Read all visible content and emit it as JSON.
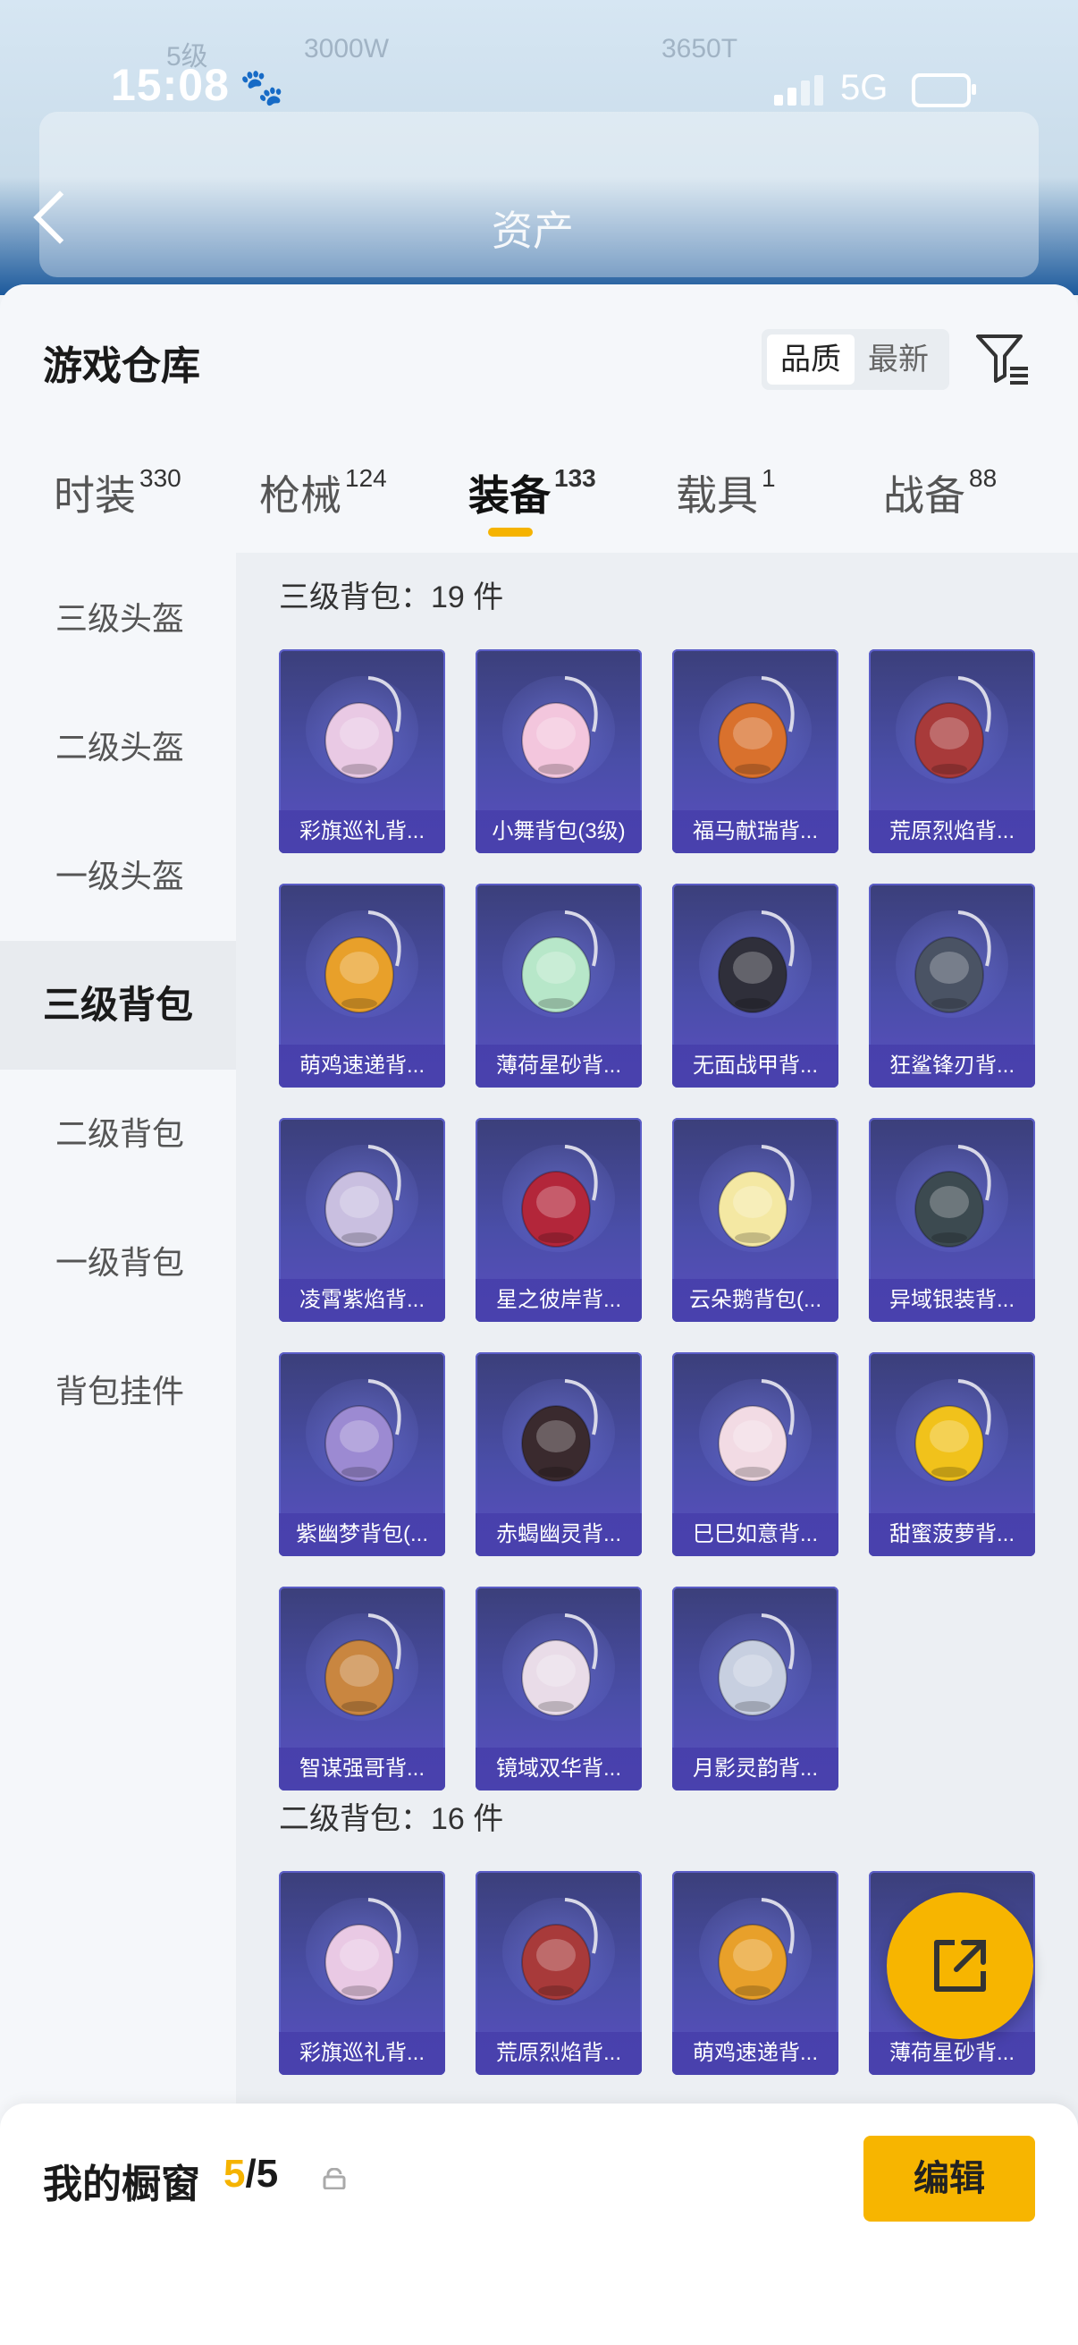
{
  "status_bar": {
    "time": "15:08",
    "network": "5G"
  },
  "header": {
    "title": "资产"
  },
  "background_stats": [
    "5级",
    "3000W",
    "3650T"
  ],
  "warehouse": {
    "title": "游戏仓库",
    "sort_options": [
      "品质",
      "最新"
    ],
    "selected_sort": "品质"
  },
  "tabs": [
    {
      "label": "时装",
      "count": "330"
    },
    {
      "label": "枪械",
      "count": "124"
    },
    {
      "label": "装备",
      "count": "133"
    },
    {
      "label": "载具",
      "count": "1"
    },
    {
      "label": "战备",
      "count": "88"
    }
  ],
  "active_tab": "装备",
  "sidebar": [
    {
      "label": "三级头盔"
    },
    {
      "label": "二级头盔"
    },
    {
      "label": "一级头盔"
    },
    {
      "label": "三级背包"
    },
    {
      "label": "二级背包"
    },
    {
      "label": "一级背包"
    },
    {
      "label": "背包挂件"
    }
  ],
  "active_sidebar": "三级背包",
  "sections": [
    {
      "title": "三级背包：19 件",
      "items": [
        {
          "name": "彩旗巡礼背...",
          "icon": "bunny-backpack-icon",
          "color": "#e9c9e4"
        },
        {
          "name": "小舞背包(3级)",
          "icon": "pink-bunny-backpack-icon",
          "color": "#f3c6dd"
        },
        {
          "name": "福马献瑞背...",
          "icon": "horse-backpack-icon",
          "color": "#d9712d"
        },
        {
          "name": "荒原烈焰背...",
          "icon": "armor-backpack-icon",
          "color": "#a83a3a"
        },
        {
          "name": "萌鸡速递背...",
          "icon": "chick-backpack-icon",
          "color": "#e8a02a"
        },
        {
          "name": "薄荷星砂背...",
          "icon": "mint-backpack-icon",
          "color": "#b7e7c9"
        },
        {
          "name": "无面战甲背...",
          "icon": "mask-backpack-icon",
          "color": "#2f2f3a"
        },
        {
          "name": "狂鲨锋刃背...",
          "icon": "shark-backpack-icon",
          "color": "#4a5364"
        },
        {
          "name": "凌霄紫焰背...",
          "icon": "crest-backpack-icon",
          "color": "#c9bfe0"
        },
        {
          "name": "星之彼岸背...",
          "icon": "astronaut-backpack-icon",
          "color": "#b3263a"
        },
        {
          "name": "云朵鹅背包(...",
          "icon": "goose-backpack-icon",
          "color": "#f4e8a3"
        },
        {
          "name": "异域银装背...",
          "icon": "tactical-backpack-icon",
          "color": "#3c4a50"
        },
        {
          "name": "紫幽梦背包(...",
          "icon": "purple-bunny-backpack-icon",
          "color": "#9c8ad2"
        },
        {
          "name": "赤蝎幽灵背...",
          "icon": "scorpion-backpack-icon",
          "color": "#3a2a2e"
        },
        {
          "name": "巳巳如意背...",
          "icon": "snake-backpack-icon",
          "color": "#f2dbe4"
        },
        {
          "name": "甜蜜菠萝背...",
          "icon": "pineapple-backpack-icon",
          "color": "#f1c21b"
        },
        {
          "name": "智谋强哥背...",
          "icon": "bear-backpack-icon",
          "color": "#c98640"
        },
        {
          "name": "镜域双华背...",
          "icon": "floral-backpack-icon",
          "color": "#e9dce8"
        },
        {
          "name": "月影灵韵背...",
          "icon": "moon-backpack-icon",
          "color": "#c7cfe0"
        }
      ]
    },
    {
      "title": "二级背包：16 件",
      "items": [
        {
          "name": "彩旗巡礼背...",
          "icon": "bunny-backpack-icon",
          "color": "#e9c9e4"
        },
        {
          "name": "荒原烈焰背...",
          "icon": "armor-backpack-icon",
          "color": "#a83a3a"
        },
        {
          "name": "萌鸡速递背...",
          "icon": "chick-backpack-icon",
          "color": "#e8a02a"
        },
        {
          "name": "薄荷星砂背...",
          "icon": "mint-backpack-icon",
          "color": "#b7e7c9"
        }
      ]
    }
  ],
  "showcase": {
    "title": "我的橱窗",
    "current": "5",
    "separator": "/",
    "total": "5",
    "edit_label": "编辑"
  },
  "colors": {
    "accent": "#f7b500",
    "card_bg": "#4a4ea8"
  }
}
